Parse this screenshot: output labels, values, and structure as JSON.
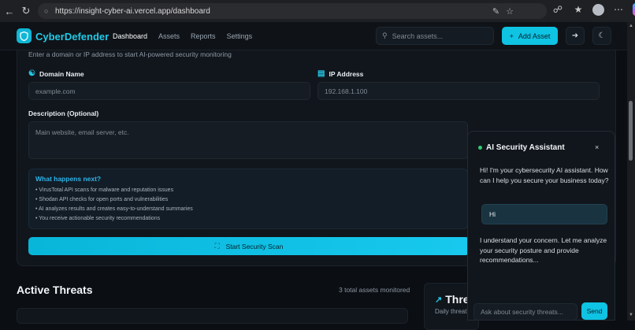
{
  "browser": {
    "url": "https://insight-cyber-ai.vercel.app/dashboard",
    "icons": [
      "back-icon",
      "refresh-icon",
      "lock-icon",
      "edit-icon",
      "star-icon",
      "extensions-icon",
      "favorites-icon",
      "profile-avatar",
      "more-icon",
      "copilot-icon"
    ]
  },
  "header": {
    "brand": "CyberDefender",
    "nav": [
      "Dashboard",
      "Assets",
      "Reports",
      "Settings"
    ],
    "active_nav": "Dashboard",
    "search_placeholder": "Search assets...",
    "add_label": "Add Asset",
    "accent": "#0fc3e3"
  },
  "form": {
    "intro": "Enter a domain or IP address to start AI-powered security monitoring",
    "domain_label": "Domain Name",
    "domain_placeholder": "example.com",
    "ip_label": "IP Address",
    "ip_placeholder": "192.168.1.100",
    "description_label": "Description (Optional)",
    "description_placeholder": "Main website, email server, etc.",
    "info_title": "What happens next?",
    "info_items": [
      "• VirusTotal API scans for malware and reputation issues",
      "• Shodan API checks for open ports and vulnerabilities",
      "• AI analyzes results and creates easy-to-understand summaries",
      "• You receive actionable security recommendations"
    ],
    "scan_label": "Start Security Scan"
  },
  "threats": {
    "title": "Active Threats",
    "count": "3 total assets monitored",
    "trend_title": "Thre",
    "trend_sub": "Daily threat d"
  },
  "chat": {
    "title": "AI Security Assistant",
    "close": "×",
    "bot_greeting": "Hi! I'm your cybersecurity AI assistant. How can I help you secure your business today?",
    "user_message": "Hi",
    "bot_reply": "I understand your concern. Let me analyze your security posture and provide recommendations...",
    "input_placeholder": "Ask about security threats...",
    "send_label": "Send",
    "status_color": "#2ecc71"
  }
}
